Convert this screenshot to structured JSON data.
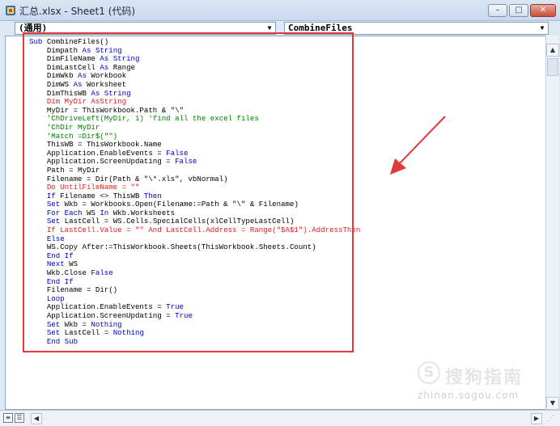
{
  "window": {
    "title": "汇总.xlsx - Sheet1 (代码)",
    "minimize_glyph": "–",
    "maximize_glyph": "□",
    "close_glyph": "✕"
  },
  "toolbar": {
    "object_value": "(通用)",
    "procedure_value": "CombineFiles"
  },
  "code": {
    "lines": [
      [
        {
          "t": "Sub ",
          "c": "kw"
        },
        {
          "t": "CombineFiles()",
          "c": ""
        }
      ],
      [
        {
          "t": "    Dimpath ",
          "c": ""
        },
        {
          "t": "As String",
          "c": "kw"
        }
      ],
      [
        {
          "t": "    DimFileName ",
          "c": ""
        },
        {
          "t": "As String",
          "c": "kw"
        }
      ],
      [
        {
          "t": "    DimLastCell ",
          "c": ""
        },
        {
          "t": "As ",
          "c": "kw"
        },
        {
          "t": "Range",
          "c": ""
        }
      ],
      [
        {
          "t": "    DimWkb ",
          "c": ""
        },
        {
          "t": "As ",
          "c": "kw"
        },
        {
          "t": "Workbook",
          "c": ""
        }
      ],
      [
        {
          "t": "    DimWS ",
          "c": ""
        },
        {
          "t": "As ",
          "c": "kw"
        },
        {
          "t": "Worksheet",
          "c": ""
        }
      ],
      [
        {
          "t": "    DimThisWB ",
          "c": ""
        },
        {
          "t": "As String",
          "c": "kw"
        }
      ],
      [
        {
          "t": "    Dim MyDir AsString",
          "c": "err"
        }
      ],
      [
        {
          "t": "    MyDir = ThisWorkbook.Path & \"\\\"",
          "c": ""
        }
      ],
      [
        {
          "t": "    'ChDriveLeft(MyDir, 1) 'find all the excel files",
          "c": "cmt"
        }
      ],
      [
        {
          "t": "    'ChDir MyDir",
          "c": "cmt"
        }
      ],
      [
        {
          "t": "    'Match =Dir$(\"\")",
          "c": "cmt"
        }
      ],
      [
        {
          "t": "    ThisWB = ThisWorkbook.Name",
          "c": ""
        }
      ],
      [
        {
          "t": "    Application.EnableEvents = ",
          "c": ""
        },
        {
          "t": "False",
          "c": "kw"
        }
      ],
      [
        {
          "t": "    Application.ScreenUpdating = ",
          "c": ""
        },
        {
          "t": "False",
          "c": "kw"
        }
      ],
      [
        {
          "t": "    Path = MyDir",
          "c": ""
        }
      ],
      [
        {
          "t": "    Filename = Dir(Path & \"\\*.xls\", vbNormal)",
          "c": ""
        }
      ],
      [
        {
          "t": "    Do UntilFileName = \"\"",
          "c": "err"
        }
      ],
      [
        {
          "t": "    If ",
          "c": "kw"
        },
        {
          "t": "Filename <> ThisWB ",
          "c": ""
        },
        {
          "t": "Then",
          "c": "kw"
        }
      ],
      [
        {
          "t": "    Set ",
          "c": "kw"
        },
        {
          "t": "Wkb = Workbooks.Open(Filename:=Path & \"\\\" & Filename)",
          "c": ""
        }
      ],
      [
        {
          "t": "    For Each ",
          "c": "kw"
        },
        {
          "t": "WS ",
          "c": ""
        },
        {
          "t": "In ",
          "c": "kw"
        },
        {
          "t": "Wkb.Worksheets",
          "c": ""
        }
      ],
      [
        {
          "t": "    Set ",
          "c": "kw"
        },
        {
          "t": "LastCell = WS.Cells.SpecialCells(xlCellTypeLastCell)",
          "c": ""
        }
      ],
      [
        {
          "t": "    If LastCell.Value = \"\" And LastCell.Address = Range(\"$A$1\").AddressThen",
          "c": "err"
        }
      ],
      [
        {
          "t": "    Else",
          "c": "kw"
        }
      ],
      [
        {
          "t": "    WS.Copy After:=ThisWorkbook.Sheets(ThisWorkbook.Sheets.Count)",
          "c": ""
        }
      ],
      [
        {
          "t": "    End If",
          "c": "kw"
        }
      ],
      [
        {
          "t": "    Next ",
          "c": "kw"
        },
        {
          "t": "WS",
          "c": ""
        }
      ],
      [
        {
          "t": "    Wkb.Close ",
          "c": ""
        },
        {
          "t": "False",
          "c": "kw"
        }
      ],
      [
        {
          "t": "    End If",
          "c": "kw"
        }
      ],
      [
        {
          "t": "    Filename = Dir()",
          "c": ""
        }
      ],
      [
        {
          "t": "    Loop",
          "c": "kw"
        }
      ],
      [
        {
          "t": "    Application.EnableEvents = ",
          "c": ""
        },
        {
          "t": "True",
          "c": "kw"
        }
      ],
      [
        {
          "t": "    Application.ScreenUpdating = ",
          "c": ""
        },
        {
          "t": "True",
          "c": "kw"
        }
      ],
      [
        {
          "t": "    Set ",
          "c": "kw"
        },
        {
          "t": "Wkb = ",
          "c": ""
        },
        {
          "t": "Nothing",
          "c": "kw"
        }
      ],
      [
        {
          "t": "    Set ",
          "c": "kw"
        },
        {
          "t": "LastCell = ",
          "c": ""
        },
        {
          "t": "Nothing",
          "c": "kw"
        }
      ],
      [
        {
          "t": "    End Sub",
          "c": "kw"
        }
      ]
    ]
  },
  "watermark": {
    "logo_glyph": "S",
    "text": "搜狗指南",
    "url": "zhinan.sogou.com"
  },
  "colors": {
    "keyword": "#0000cc",
    "comment": "#008000",
    "error": "#e0201e",
    "highlight_box": "#e03a3a",
    "arrow": "#e03a3a"
  }
}
